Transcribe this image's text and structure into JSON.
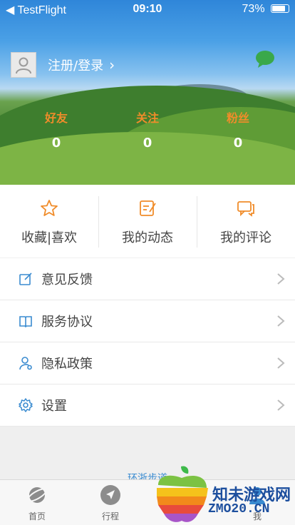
{
  "status_bar": {
    "carrier": "◀ TestFlight",
    "time": "09:10",
    "battery": "73%",
    "battery_level": 0.73
  },
  "profile": {
    "login_text": "注册/登录",
    "avatar_icon": "user-icon",
    "message_icon": "chat-bubble-icon"
  },
  "stats": [
    {
      "label": "好友",
      "value": "0"
    },
    {
      "label": "关注",
      "value": "0"
    },
    {
      "label": "粉丝",
      "value": "0"
    }
  ],
  "actions": [
    {
      "label": "收藏|喜欢",
      "icon": "star-icon"
    },
    {
      "label": "我的动态",
      "icon": "edit-note-icon"
    },
    {
      "label": "我的评论",
      "icon": "comment-icon"
    }
  ],
  "menu": [
    {
      "label": "意见反馈",
      "icon": "feedback-icon"
    },
    {
      "label": "服务协议",
      "icon": "book-icon"
    },
    {
      "label": "隐私政策",
      "icon": "privacy-user-icon"
    },
    {
      "label": "设置",
      "icon": "settings-gear-icon"
    }
  ],
  "partial_text": "环浙步道",
  "tabs": [
    {
      "label": "首页",
      "icon": "planet-icon"
    },
    {
      "label": "行程",
      "icon": "navigation-icon"
    },
    {
      "label": "我",
      "icon": "me-icon"
    }
  ],
  "watermark": {
    "name": "知未游戏网",
    "url": "ZMO20.CN"
  },
  "colors": {
    "accent_orange": "#f08c2a",
    "accent_blue": "#3a8bd0"
  }
}
